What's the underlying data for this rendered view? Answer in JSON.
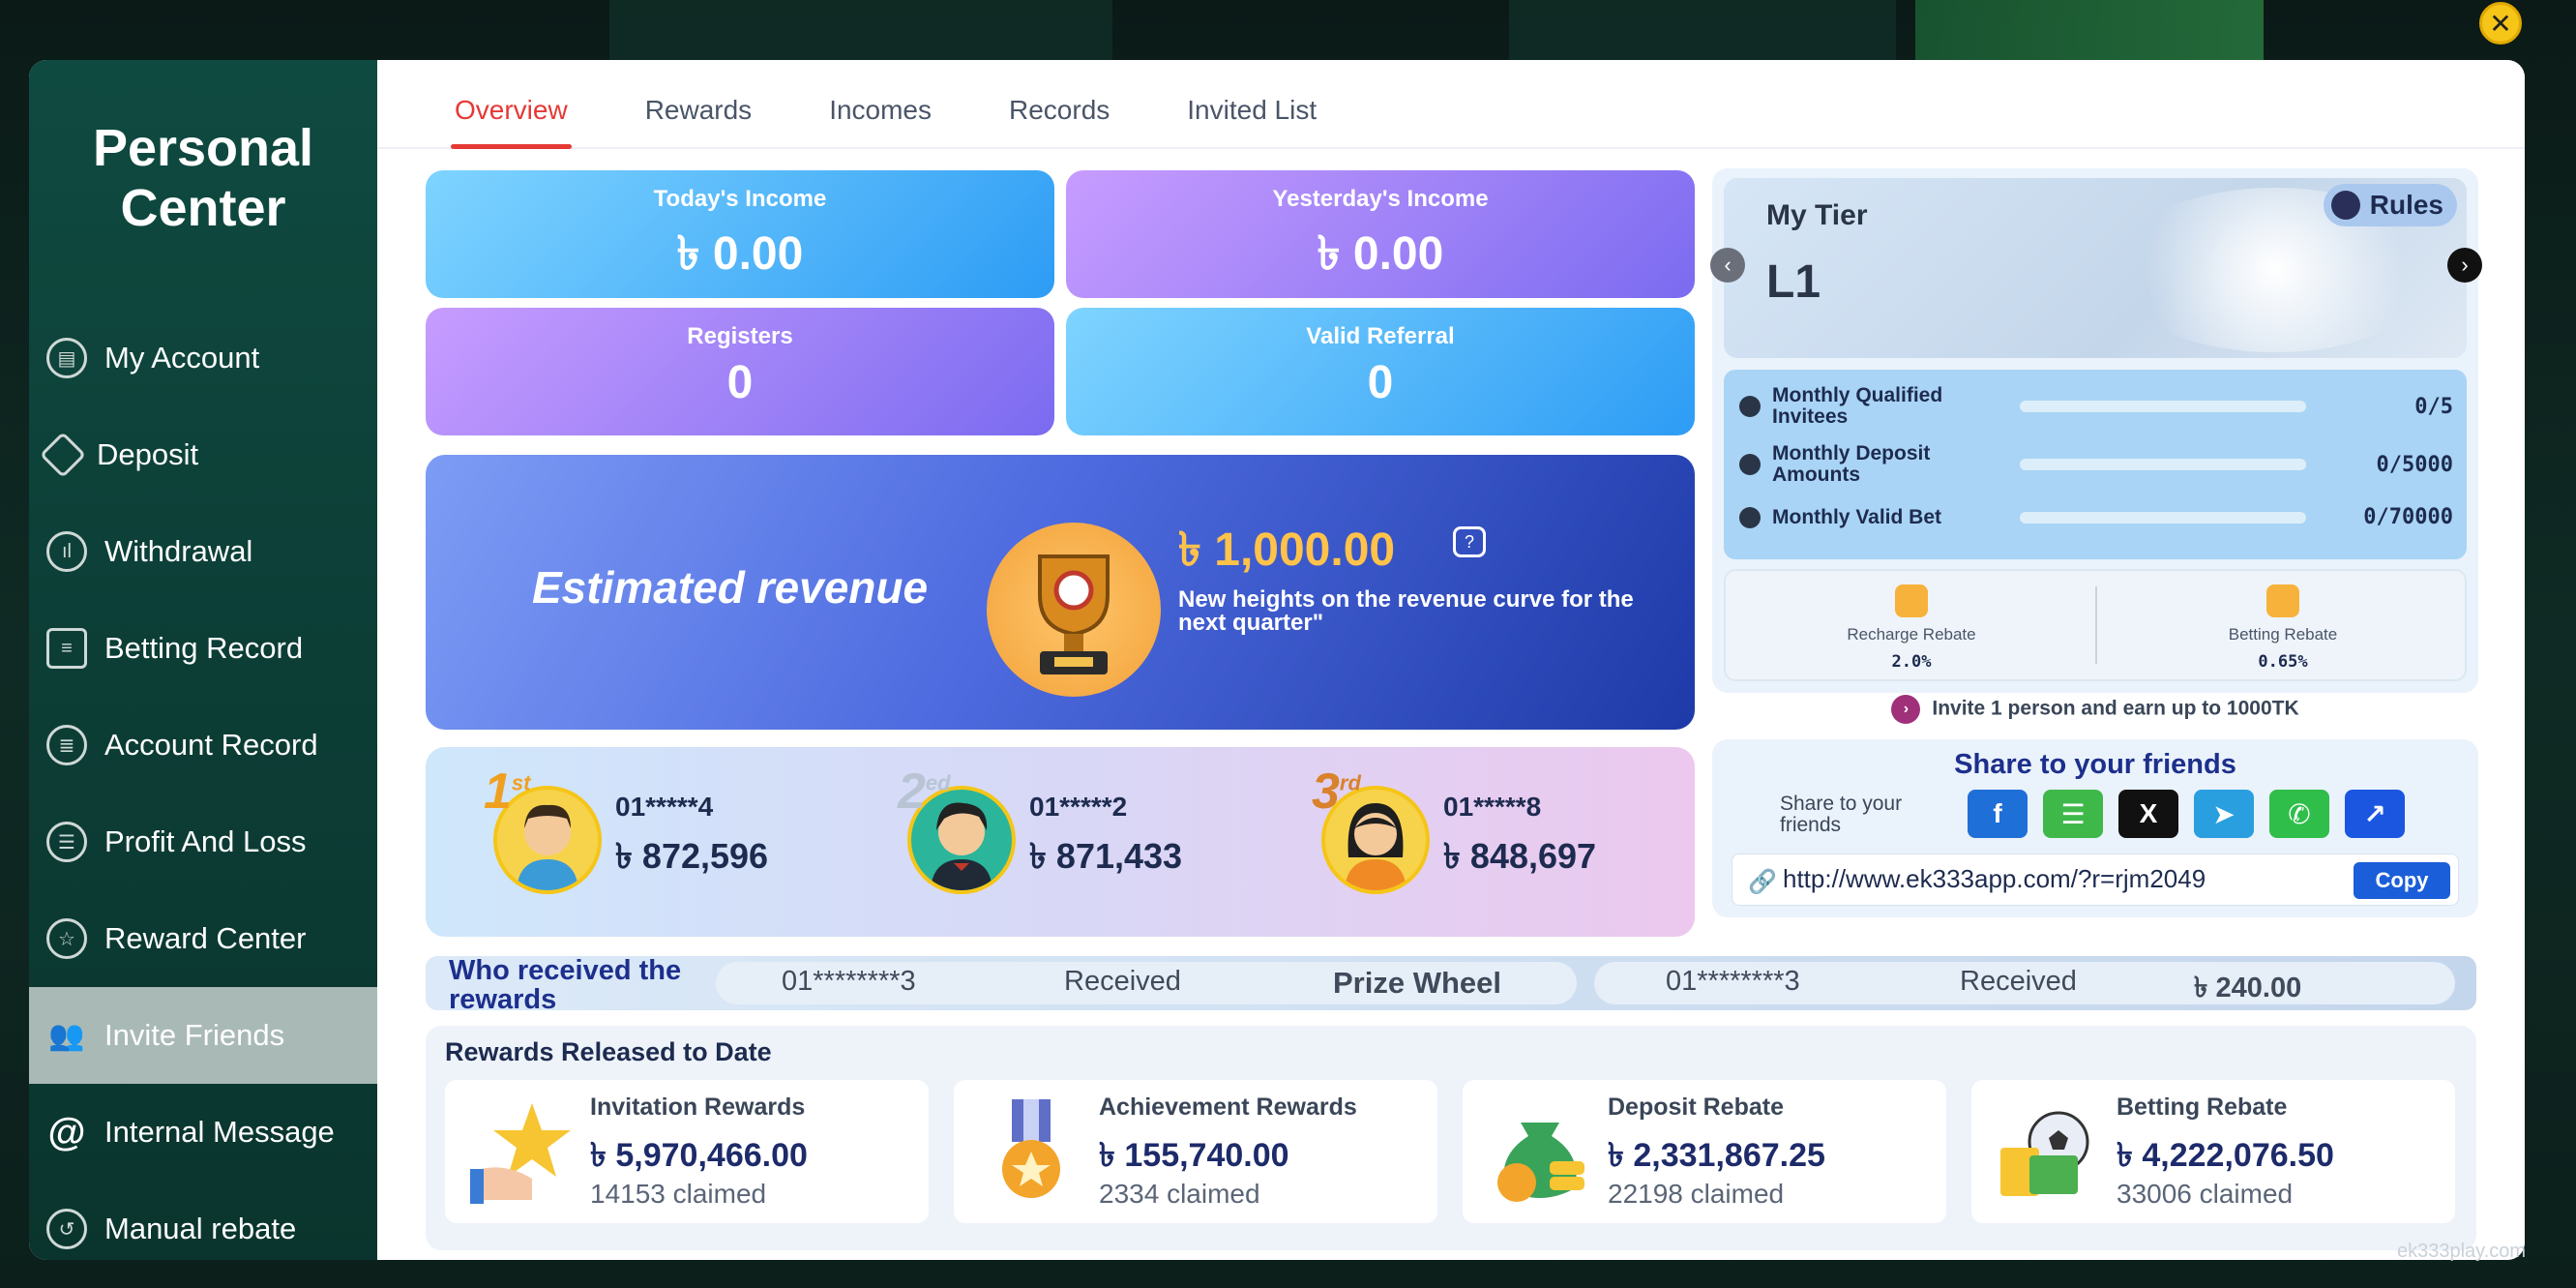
{
  "sidebar": {
    "title_line1": "Personal",
    "title_line2": "Center",
    "items": [
      {
        "label": "My Account",
        "icon": "wallet-icon"
      },
      {
        "label": "Deposit",
        "icon": "ticket-icon"
      },
      {
        "label": "Withdrawal",
        "icon": "chart-icon"
      },
      {
        "label": "Betting Record",
        "icon": "clipboard-icon"
      },
      {
        "label": "Account Record",
        "icon": "ledger-icon"
      },
      {
        "label": "Profit And Loss",
        "icon": "list-icon"
      },
      {
        "label": "Reward Center",
        "icon": "star-icon"
      },
      {
        "label": "Invite Friends",
        "icon": "add-user-icon"
      },
      {
        "label": "Internal Message",
        "icon": "at-icon"
      },
      {
        "label": "Manual rebate",
        "icon": "rebate-icon"
      }
    ]
  },
  "tabs": [
    "Overview",
    "Rewards",
    "Incomes",
    "Records",
    "Invited List"
  ],
  "stats": {
    "todays_income_label": "Today's Income",
    "todays_income": "৳  0.00",
    "yesterdays_income_label": "Yesterday's Income",
    "yesterdays_income": "৳  0.00",
    "registers_label": "Registers",
    "registers": "0",
    "valid_referral_label": "Valid Referral",
    "valid_referral": "0"
  },
  "estimated": {
    "title": "Estimated revenue",
    "amount": "৳  1,000.00",
    "subtitle": "New heights on the revenue curve for the next quarter\""
  },
  "ranking": [
    {
      "rank": "1",
      "suffix": "st",
      "name": "01*****4",
      "amount": "৳ 872,596"
    },
    {
      "rank": "2",
      "suffix": "ed",
      "name": "01*****2",
      "amount": "৳ 871,433"
    },
    {
      "rank": "3",
      "suffix": "rd",
      "name": "01*****8",
      "amount": "৳ 848,697"
    }
  ],
  "ticker": {
    "title": "Who received the rewards",
    "row1_user": "01********3",
    "row1_status": "Received",
    "row1_prize": "Prize Wheel",
    "row2_user": "01********3",
    "row2_status": "Received",
    "row2_amount": "৳   240.00"
  },
  "released": {
    "title": "Rewards Released to Date",
    "cards": [
      {
        "name": "Invitation Rewards",
        "amount": "৳  5,970,466.00",
        "claimed": "14153 claimed"
      },
      {
        "name": "Achievement Rewards",
        "amount": "৳  155,740.00",
        "claimed": "2334 claimed"
      },
      {
        "name": "Deposit Rebate",
        "amount": "৳  2,331,867.25",
        "claimed": "22198 claimed"
      },
      {
        "name": "Betting Rebate",
        "amount": "৳  4,222,076.50",
        "claimed": "33006 claimed"
      }
    ]
  },
  "tier": {
    "label": "My Tier",
    "level": "L1",
    "rules": "Rules",
    "requirements": [
      {
        "name": "Monthly Qualified Invitees",
        "value": "0/5",
        "progress": 0
      },
      {
        "name": "Monthly Deposit Amounts",
        "value": "0/5000",
        "progress": 0
      },
      {
        "name": "Monthly Valid Bet",
        "value": "0/70000",
        "progress": 0
      }
    ],
    "recharge_rebate_label": "Recharge Rebate",
    "recharge_rebate": "2.0%",
    "betting_rebate_label": "Betting Rebate",
    "betting_rebate": "0.65%",
    "invite_text": "Invite 1 person and earn up to 1000TK"
  },
  "share": {
    "title": "Share to your friends",
    "label": "Share to your friends",
    "url": "http://www.ek333app.com/?r=rjm2049",
    "copy": "Copy",
    "networks": [
      "facebook-icon",
      "sms-icon",
      "x-icon",
      "telegram-icon",
      "whatsapp-icon",
      "share-icon"
    ]
  },
  "watermark": "ek333play.com",
  "colors": {
    "accent": "#e53935",
    "sidebar": "#0f4a40",
    "brand_blue": "#1d2f8c"
  }
}
